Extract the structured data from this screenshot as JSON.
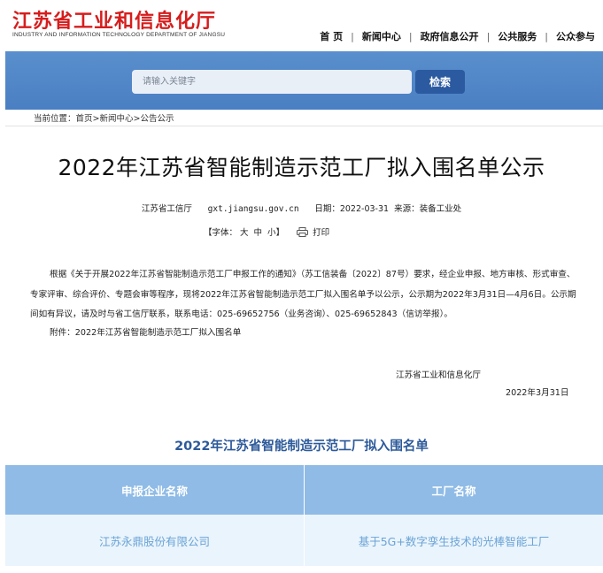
{
  "header": {
    "logo_cn": "江苏省工业和信息化厅",
    "logo_en": "INDUSTRY AND INFORMATION TECHNOLOGY DEPARTMENT OF JIANGSU",
    "nav": [
      "首 页",
      "新闻中心",
      "政府信息公开",
      "公共服务",
      "公众参与"
    ],
    "nav_separator": "|"
  },
  "search": {
    "placeholder": "请输入关键字",
    "button_label": "检索"
  },
  "breadcrumb": {
    "prefix": "当前位置：",
    "items": [
      "首页",
      "新闻中心",
      "公告公示"
    ],
    "separator": ">"
  },
  "article": {
    "title": "2022年江苏省智能制造示范工厂拟入围名单公示",
    "meta_source": "江苏省工信厅",
    "meta_site": "gxt.jiangsu.gov.cn",
    "meta_date": "日期：2022-03-31",
    "meta_from": "来源：装备工业处",
    "font_size_label": "【字体：",
    "font_large": "大",
    "font_medium": "中",
    "font_small": "小",
    "font_size_end": "】",
    "print_label": "打印",
    "body": "根据《关于开展2022年江苏省智能制造示范工厂申报工作的通知》（苏工信装备〔2022〕87号）要求，经企业申报、地方审核、形式审查、专家评审、综合评价、专题会审等程序，现将2022年江苏省智能制造示范工厂拟入围名单予以公示，公示期为2022年3月31日—4月6日。公示期间如有异议，请及时与省工信厅联系，联系电话：025-69652756（业务咨询）、025-69652843（信访举报）。",
    "attachment": "附件：2022年江苏省智能制造示范工厂拟入围名单",
    "signature_org": "江苏省工业和信息化厅",
    "signature_date": "2022年3月31日"
  },
  "list": {
    "title": "2022年江苏省智能制造示范工厂拟入围名单",
    "columns": [
      "申报企业名称",
      "工厂名称"
    ],
    "rows": [
      [
        "江苏永鼎股份有限公司",
        "基于5G+数字孪生技术的光棒智能工厂"
      ]
    ]
  },
  "colors": {
    "logo_red": "#d61d1d",
    "banner_blue": "#4a7fc3",
    "button_blue": "#2b5aa0",
    "list_title_blue": "#2d5a9a",
    "table_header": "#8fbbe6",
    "table_row": "#eaf4fc",
    "table_text": "#6aa3d6"
  },
  "icons": {
    "print": "printer-icon"
  }
}
